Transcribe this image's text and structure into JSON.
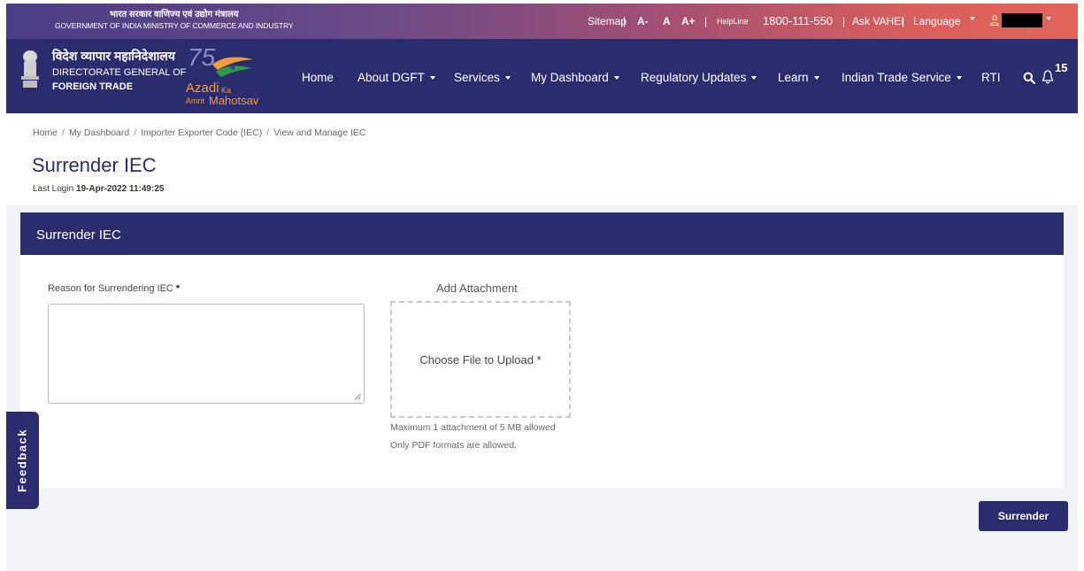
{
  "topbar": {
    "gov_hindi": "भारत सरकार  वाणिज्य एवं उद्योग मंत्रालय",
    "gov_english": "GOVERNMENT OF INDIA  MINISTRY OF COMMERCE AND INDUSTRY",
    "sitemap": "Sitemap",
    "sep": "|",
    "font_minus": "A-",
    "font_normal": "A",
    "font_plus": "A+",
    "helpline_label": "HelpLine",
    "helpline_number": "1800-111-550",
    "ask": "Ask VAHEI",
    "language": "Language"
  },
  "nav": {
    "org_hindi": "विदेश व्यापार महानिदेशालय",
    "org_en_line1": "DIRECTORATE GENERAL OF",
    "org_en_line2": "FOREIGN TRADE",
    "azadi_75": "75",
    "azadi_word": "Azadi",
    "azadi_ka": "Ka",
    "azadi_amrit": "Amrit",
    "azadi_mahotsav": "Mahotsav",
    "items": [
      {
        "label": "Home"
      },
      {
        "label": "About DGFT"
      },
      {
        "label": "Services"
      },
      {
        "label": "My Dashboard"
      },
      {
        "label": "Regulatory Updates"
      },
      {
        "label": "Learn"
      },
      {
        "label": "Indian Trade Service"
      },
      {
        "label": "RTI"
      }
    ],
    "notification_count": "15"
  },
  "breadcrumb": [
    "Home",
    "My Dashboard",
    "Importer Exporter Code (IEC)",
    "View and Manage IEC"
  ],
  "breadcrumb_sep": "/",
  "page": {
    "title": "Surrender IEC",
    "last_login_label": "Last Login",
    "last_login_value": "19-Apr-2022 11:49:25"
  },
  "card": {
    "title": "Surrender IEC",
    "reason_label": "Reason for Surrendering IEC",
    "required_mark": "*",
    "reason_value": "",
    "attachment_label": "Add Attachment",
    "upload_text": "Choose File to Upload *",
    "hint_size": "Maximum 1 attachment of 5 MB allowed",
    "hint_format": "Only PDF formats are allowed."
  },
  "actions": {
    "surrender": "Surrender"
  },
  "feedback": "Feedback",
  "colors": {
    "primary": "#2b2c6e",
    "saffron": "#f29c3a",
    "green": "#2e9a47"
  }
}
